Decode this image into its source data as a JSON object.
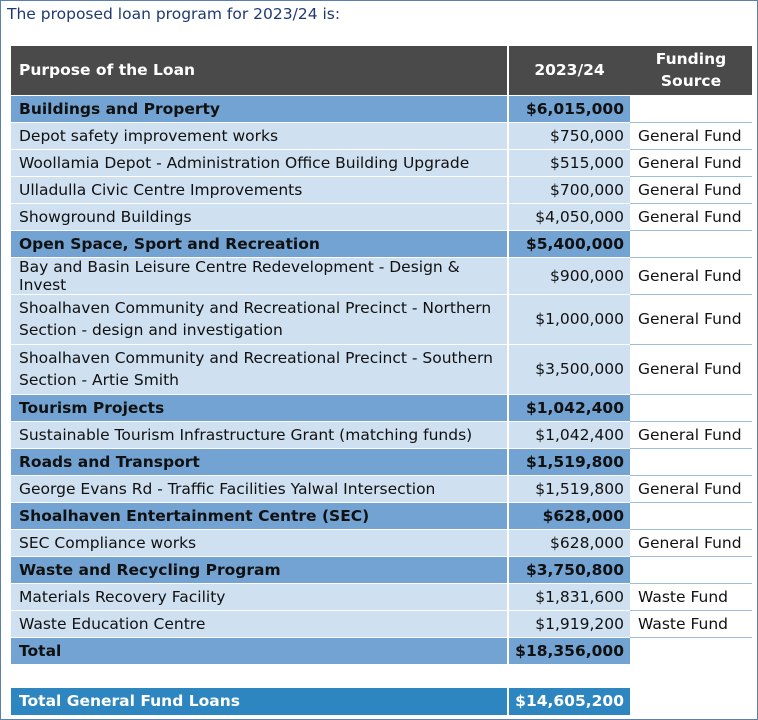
{
  "intro": "The proposed loan program for 2023/24 is:",
  "table": {
    "headers": {
      "purpose": "Purpose of the Loan",
      "year": "2023/24",
      "source_line1": "Funding",
      "source_line2": "Source"
    },
    "rows": [
      {
        "type": "cat",
        "purpose": "Buildings and Property",
        "amount": "$6,015,000",
        "source": ""
      },
      {
        "type": "item",
        "purpose": "Depot safety improvement works",
        "amount": "$750,000",
        "source": "General Fund"
      },
      {
        "type": "item",
        "purpose": "Woollamia Depot - Administration Office Building Upgrade",
        "amount": "$515,000",
        "source": "General Fund"
      },
      {
        "type": "item",
        "purpose": "Ulladulla Civic Centre Improvements",
        "amount": "$700,000",
        "source": "General Fund"
      },
      {
        "type": "item",
        "purpose": "Showground Buildings",
        "amount": "$4,050,000",
        "source": "General Fund"
      },
      {
        "type": "cat",
        "purpose": "Open Space, Sport and Recreation",
        "amount": "$5,400,000",
        "source": ""
      },
      {
        "type": "item",
        "purpose": "Bay and Basin Leisure Centre Redevelopment - Design & Invest",
        "amount": "$900,000",
        "source": "General Fund"
      },
      {
        "type": "item2",
        "purpose_line1": "Shoalhaven Community and Recreational Precinct - Northern",
        "purpose_line2": "Section - design and investigation",
        "amount": "$1,000,000",
        "source": "General Fund"
      },
      {
        "type": "item2",
        "purpose_line1": "Shoalhaven Community and Recreational Precinct - Southern",
        "purpose_line2": "Section - Artie Smith",
        "amount": "$3,500,000",
        "source": "General Fund"
      },
      {
        "type": "cat",
        "purpose": "Tourism Projects",
        "amount": "$1,042,400",
        "source": ""
      },
      {
        "type": "item",
        "purpose": "Sustainable Tourism Infrastructure Grant (matching funds)",
        "amount": "$1,042,400",
        "source": "General Fund"
      },
      {
        "type": "cat",
        "purpose": "Roads and Transport",
        "amount": "$1,519,800",
        "source": ""
      },
      {
        "type": "item",
        "purpose": "George Evans Rd - Traffic Facilities Yalwal Intersection",
        "amount": "$1,519,800",
        "source": "General Fund"
      },
      {
        "type": "cat",
        "purpose": "Shoalhaven Entertainment Centre (SEC)",
        "amount": "$628,000",
        "source": ""
      },
      {
        "type": "item",
        "purpose": "SEC Compliance works",
        "amount": "$628,000",
        "source": "General Fund"
      },
      {
        "type": "cat",
        "purpose": "Waste and Recycling Program",
        "amount": "$3,750,800",
        "source": ""
      },
      {
        "type": "item",
        "purpose": "Materials Recovery Facility",
        "amount": "$1,831,600",
        "source": "Waste Fund"
      },
      {
        "type": "item",
        "purpose": "Waste Education Centre",
        "amount": "$1,919,200",
        "source": "Waste Fund"
      }
    ],
    "total": {
      "label": "Total",
      "amount": "$18,356,000"
    }
  },
  "general_fund": {
    "label": "Total General Fund Loans",
    "amount": "$14,605,200"
  }
}
